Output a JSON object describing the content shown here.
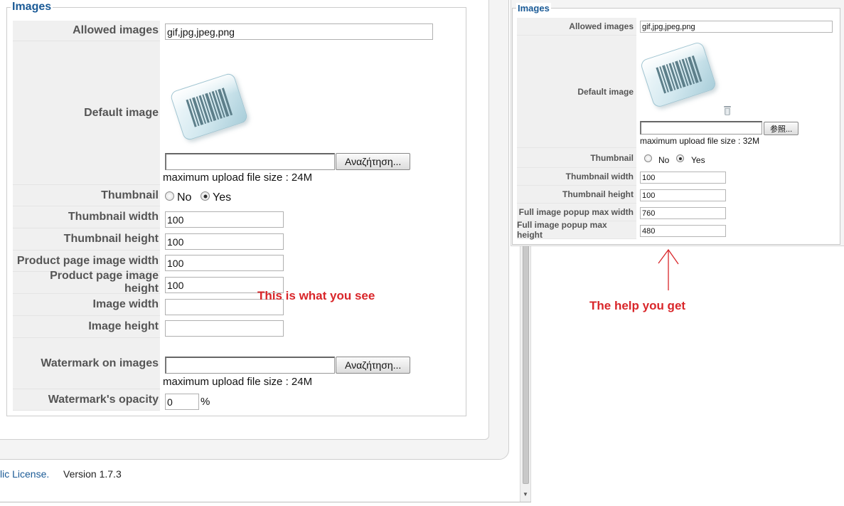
{
  "left_panel": {
    "legend": "Images",
    "allowed_images": {
      "label": "Allowed images",
      "value": "gif,jpg,jpeg,png"
    },
    "default_image": {
      "label": "Default image",
      "browse_button": "Αναζήτηση...",
      "max_upload": "maximum upload file size : 24M"
    },
    "thumbnail": {
      "label": "Thumbnail",
      "option_no": "No",
      "option_yes": "Yes",
      "selected": "Yes"
    },
    "thumbnail_width": {
      "label": "Thumbnail width",
      "value": "100"
    },
    "thumbnail_height": {
      "label": "Thumbnail height",
      "value": "100"
    },
    "product_page_image_width": {
      "label": "Product page image width",
      "value": "100"
    },
    "product_page_image_height": {
      "label": "Product page image height",
      "value": "100"
    },
    "image_width": {
      "label": "Image width",
      "value": ""
    },
    "image_height": {
      "label": "Image height",
      "value": ""
    },
    "watermark_on_images": {
      "label": "Watermark on images",
      "browse_button": "Αναζήτηση...",
      "max_upload": "maximum upload file size : 24M"
    },
    "watermark_opacity": {
      "label": "Watermark's opacity",
      "value": "0",
      "unit": "%"
    }
  },
  "footer": {
    "license_link": "lic License.",
    "version": "Version 1.7.3"
  },
  "right_panel": {
    "legend": "Images",
    "allowed_images": {
      "label": "Allowed images",
      "value": "gif,jpg,jpeg,png"
    },
    "default_image": {
      "label": "Default image",
      "browse_button": "参照...",
      "max_upload": "maximum upload file size : 32M"
    },
    "thumbnail": {
      "label": "Thumbnail",
      "option_no": "No",
      "option_yes": "Yes",
      "selected": "Yes"
    },
    "thumbnail_width": {
      "label": "Thumbnail width",
      "value": "100"
    },
    "thumbnail_height": {
      "label": "Thumbnail height",
      "value": "100"
    },
    "full_image_popup_max_width": {
      "label": "Full image popup max width",
      "value": "760"
    },
    "full_image_popup_max_height": {
      "label": "Full image popup max height",
      "value": "480"
    }
  },
  "annotations": {
    "left": "This is what you see",
    "right": "The help you get"
  },
  "colors": {
    "legend": "#1a5a96",
    "annotation": "#d9262a",
    "label": "#555555",
    "link": "#1a5a96"
  },
  "icons": {
    "default_image": "barcode-icon",
    "trash": "trash-icon",
    "arrow": "up-arrow-icon"
  }
}
